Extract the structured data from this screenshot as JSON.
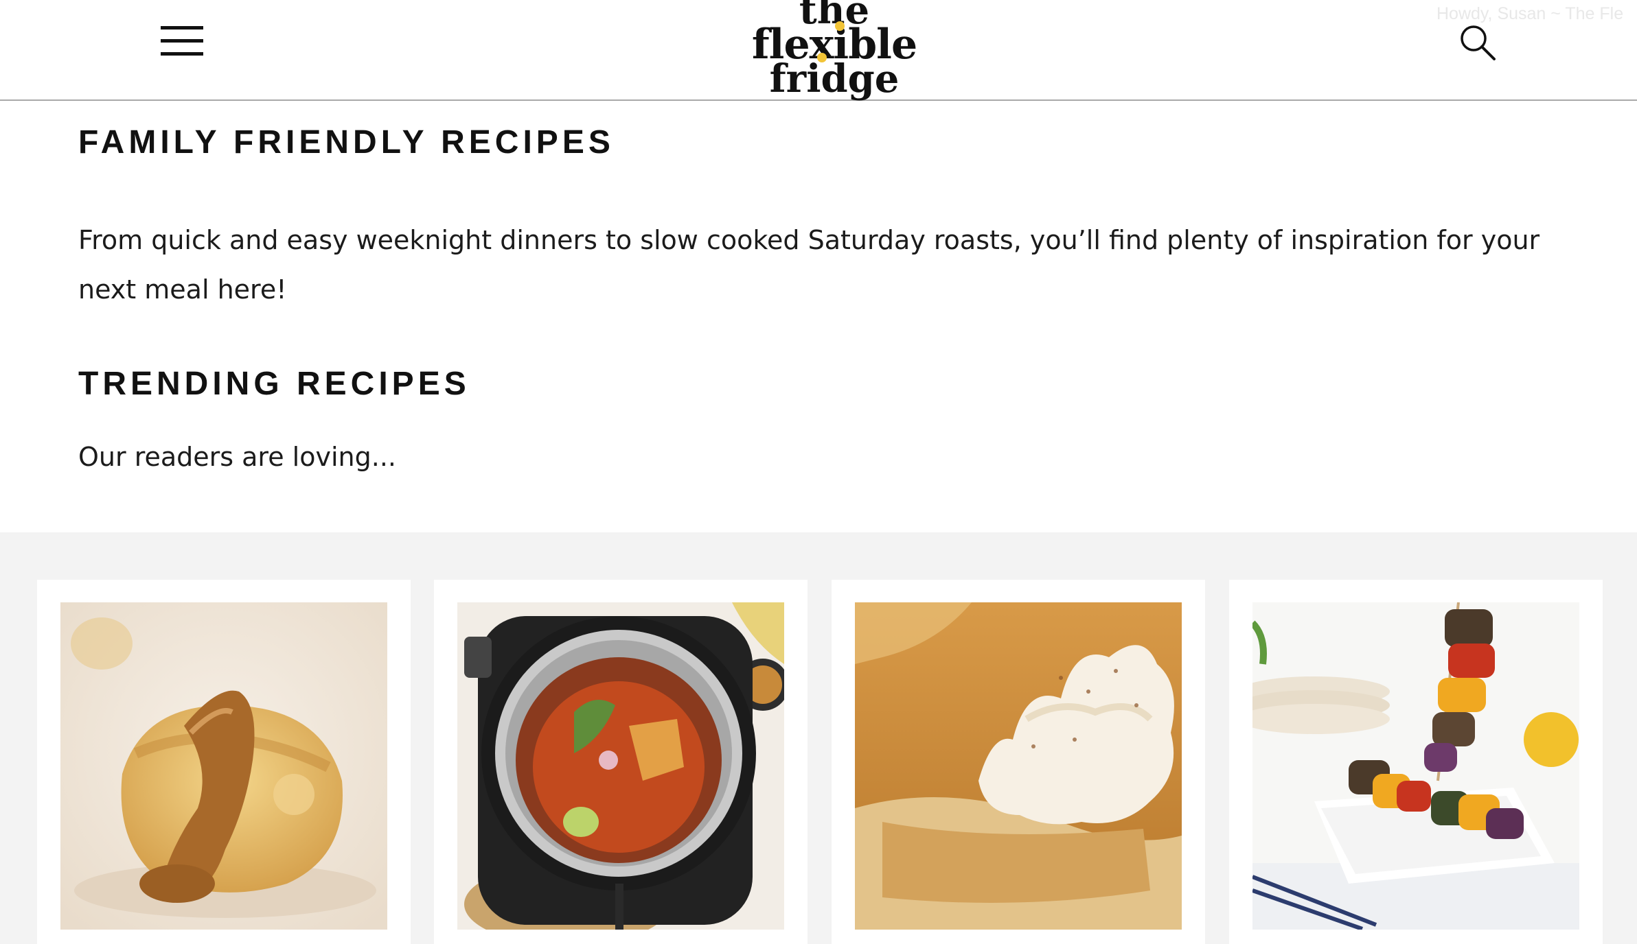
{
  "header": {
    "logo": {
      "line1": "the",
      "line2": "flexible",
      "line3": "fridge"
    },
    "menu_icon": "hamburger-menu-icon",
    "search_icon": "search-icon",
    "admin_greeting": "Howdy, Susan ~ The Fle"
  },
  "family_section": {
    "title": "FAMILY FRIENDLY RECIPES",
    "description": "From quick and easy weeknight dinners to slow cooked Saturday roasts, you’ll find plenty of inspiration for your next meal here!"
  },
  "trending_section": {
    "title": "TRENDING RECIPES",
    "subtitle": "Our readers are loving..."
  },
  "cards": [
    {
      "image": "apple-pie-with-caramel-sauce-photo"
    },
    {
      "image": "instant-pot-tortilla-soup-photo"
    },
    {
      "image": "pumpkin-pie-with-whipped-cream-photo"
    },
    {
      "image": "vegetable-kebab-skewers-photo"
    }
  ],
  "colors": {
    "logo_accent": "#f2c437",
    "grid_background": "#f3f3f3",
    "header_border": "#a9a9a9"
  }
}
